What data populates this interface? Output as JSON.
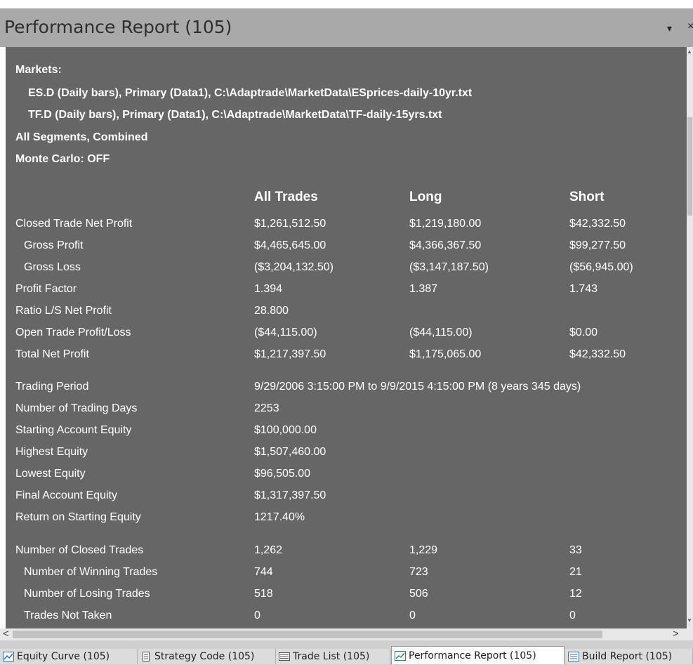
{
  "panel": {
    "title": "Performance Report (105)",
    "pin_glyph": "▾",
    "close_glyph": "×"
  },
  "header_info": {
    "markets_label": "Markets:",
    "market_lines": [
      "ES.D (Daily bars), Primary (Data1), C:\\Adaptrade\\MarketData\\ESprices-daily-10yr.txt",
      "TF.D (Daily bars), Primary (Data1), C:\\Adaptrade\\MarketData\\TF-daily-15yrs.txt"
    ],
    "segments": "All Segments, Combined",
    "monte_carlo": "Monte Carlo: OFF"
  },
  "columns": {
    "all": "All Trades",
    "long": "Long",
    "short": "Short"
  },
  "rows": [
    {
      "label": "Closed Trade Net Profit",
      "all": "$1,261,512.50",
      "long": "$1,219,180.00",
      "short": "$42,332.50"
    },
    {
      "label": "Gross Profit",
      "all": "$4,465,645.00",
      "long": "$4,366,367.50",
      "short": "$99,277.50"
    },
    {
      "label": "Gross Loss",
      "all": "($3,204,132.50)",
      "long": "($3,147,187.50)",
      "short": "($56,945.00)"
    },
    {
      "label": "Profit Factor",
      "all": "1.394",
      "long": "1.387",
      "short": "1.743"
    },
    {
      "label": "Ratio L/S Net Profit",
      "all": "28.800",
      "long": "",
      "short": ""
    },
    {
      "label": "Open Trade Profit/Loss",
      "all": "($44,115.00)",
      "long": "($44,115.00)",
      "short": "$0.00"
    },
    {
      "label": "Total Net Profit",
      "all": "$1,217,397.50",
      "long": "$1,175,065.00",
      "short": "$42,332.50"
    },
    {
      "label": "Trading Period",
      "all": "9/29/2006 3:15:00 PM to 9/9/2015 4:15:00 PM (8 years 345 days)",
      "long": "",
      "short": ""
    },
    {
      "label": "Number of Trading Days",
      "all": "2253",
      "long": "",
      "short": ""
    },
    {
      "label": "Starting Account Equity",
      "all": "$100,000.00",
      "long": "",
      "short": ""
    },
    {
      "label": "Highest Equity",
      "all": "$1,507,460.00",
      "long": "",
      "short": ""
    },
    {
      "label": "Lowest Equity",
      "all": "$96,505.00",
      "long": "",
      "short": ""
    },
    {
      "label": "Final Account Equity",
      "all": "$1,317,397.50",
      "long": "",
      "short": ""
    },
    {
      "label": "Return on Starting Equity",
      "all": "1217.40%",
      "long": "",
      "short": ""
    },
    {
      "label": "Number of Closed Trades",
      "all": "1,262",
      "long": "1,229",
      "short": "33"
    },
    {
      "label": "Number of Winning Trades",
      "all": "744",
      "long": "723",
      "short": "21"
    },
    {
      "label": "Number of Losing Trades",
      "all": "518",
      "long": "506",
      "short": "12"
    },
    {
      "label": "Trades Not Taken",
      "all": "0",
      "long": "0",
      "short": "0"
    }
  ],
  "scroll": {
    "left": "<",
    "right": ">",
    "up": "▲",
    "down": "▼"
  },
  "tabs": [
    {
      "label": "Equity Curve (105)",
      "icon": "line-chart-icon"
    },
    {
      "label": "Strategy Code (105)",
      "icon": "document-icon"
    },
    {
      "label": "Trade List (105)",
      "icon": "list-icon"
    },
    {
      "label": "Performance Report (105)",
      "icon": "report-icon"
    },
    {
      "label": "Build Report (105)",
      "icon": "build-report-icon"
    }
  ]
}
